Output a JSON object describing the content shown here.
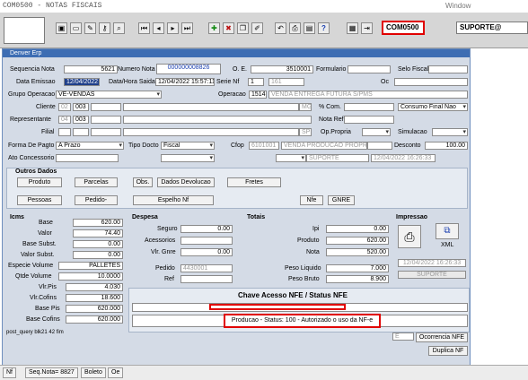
{
  "app": {
    "title": "COM0500 - NOTAS FISCAIS",
    "window_menu": "Window"
  },
  "toolbar": {
    "module_code": "COM0500",
    "user": "SUPORTE@"
  },
  "form": {
    "window_title": "Denver Erp",
    "sequencia_nota_label": "Sequencia Nota",
    "sequencia_nota": "5621",
    "numero_nota_label": "Numero Nota",
    "numero_nota": "000000008826",
    "oe_label": "O. E.",
    "oe": "3510001",
    "formulario_label": "Formulario",
    "formulario": "",
    "selo_fiscal_label": "Selo Fiscal",
    "selo_fiscal": "",
    "data_emissao_label": "Data Emissao",
    "data_emissao": "12/04/2022",
    "data_hora_saida_label": "Data/Hora Saida",
    "data_hora_saida": "12/04/2022 15:57:11",
    "serie_nf_label": "Serie Nf",
    "serie_nf": "1",
    "serie_nf_code": "161",
    "oc_label": "Oc",
    "oc": "",
    "grupo_operacao_label": "Grupo Operacao",
    "grupo_operacao": "VE-VENDAS",
    "operacao_label": "Operacao",
    "operacao_code": "1514",
    "operacao_desc": "VENDA ENTREGA FUTURA S/PMS",
    "cliente_label": "Cliente",
    "cliente_a": "02",
    "cliente_b": "003",
    "cliente_uf": "MG",
    "pct_com_label": "% Com.",
    "consumo_final": "Consumo Final Nao",
    "representante_label": "Representante",
    "representante_a": "04",
    "representante_b": "003",
    "nota_ref_label": "Nota Ref",
    "filial_label": "Filial",
    "filial_uf": "SP",
    "op_propria_label": "Op.Propria",
    "simulacao_label": "Simulacao",
    "forma_pagto_label": "Forma De Pagto",
    "forma_pagto": "A Prazo",
    "tipo_docto_label": "Tipo Docto",
    "tipo_docto": "Fiscal",
    "cfop_label": "Cfop",
    "cfop": "6101001",
    "cfop_desc": "VENDA PRODUCAO PROPRIA",
    "desconto_label": "Desconto",
    "desconto": "100.00",
    "ato_concessorio_label": "Ato Concessorio",
    "suporte": "SUPORTE",
    "suporte_data": "12/04/2022 16:26:33"
  },
  "outros_dados": {
    "title": "Outros Dados",
    "produto": "Produto",
    "parcelas": "Parcelas",
    "obs": "Obs.",
    "dados_devolucao": "Dados Devolucao",
    "fretes": "Fretes",
    "pessoas": "Pessoas",
    "pedido": "Pedido-",
    "espelho_nf": "Espelho Nf",
    "nfe": "Nfe",
    "gnre": "GNRE"
  },
  "icms": {
    "title": "Icms",
    "rows": [
      {
        "label": "Base",
        "value": "620.00"
      },
      {
        "label": "Valor",
        "value": "74.40"
      },
      {
        "label": "Base Subst.",
        "value": "0.00"
      },
      {
        "label": "Valor Subst.",
        "value": "0.00"
      },
      {
        "label": "Especie Volume",
        "value": "PALLETES"
      },
      {
        "label": "Qtde Volume",
        "value": "10.0000"
      },
      {
        "label": "Vlr.Pis",
        "value": "4.030"
      },
      {
        "label": "Vlr.Cofins",
        "value": "18.600"
      },
      {
        "label": "Base Pis",
        "value": "620.000"
      },
      {
        "label": "Base Cofins",
        "value": "620.000"
      }
    ]
  },
  "despesa": {
    "title": "Despesa",
    "seguro_label": "Seguro",
    "seguro": "0.00",
    "acessorios_label": "Acessorios",
    "vlr_gnre_label": "Vlr. Gnre",
    "vlr_gnre": "0.00",
    "pedido_label": "Pedido",
    "pedido": "4430001",
    "ref_label": "Ref"
  },
  "totais": {
    "title": "Totais",
    "ipi_label": "Ipi",
    "ipi": "0.00",
    "produto_label": "Produto",
    "produto": "620.00",
    "nota_label": "Nota",
    "nota": "520.00",
    "peso_liquido_label": "Peso Liquido",
    "peso_liquido": "7.000",
    "peso_bruto_label": "Peso Bruto",
    "peso_bruto": "8.900"
  },
  "impressao": {
    "title": "Impressao",
    "xml": "XML",
    "data": "12/04/2022 16:26:33",
    "usuario": "SUPORTE"
  },
  "nfe": {
    "chave_title": "Chave Acesso NFE / Status NFE",
    "chave": "",
    "status": "Producao - Status: 100 - Autorizado o uso da NF-e",
    "ocorrencia": "Ocorrencia NFE",
    "duplica": "Duplica NF",
    "e_field": "E"
  },
  "debug_text": "post_query blk21 42 fim",
  "statusbar": {
    "nf": "Nf",
    "seq": "Seq.Nota= 8827",
    "boleto": "Boleto",
    "oe": "Oe"
  }
}
